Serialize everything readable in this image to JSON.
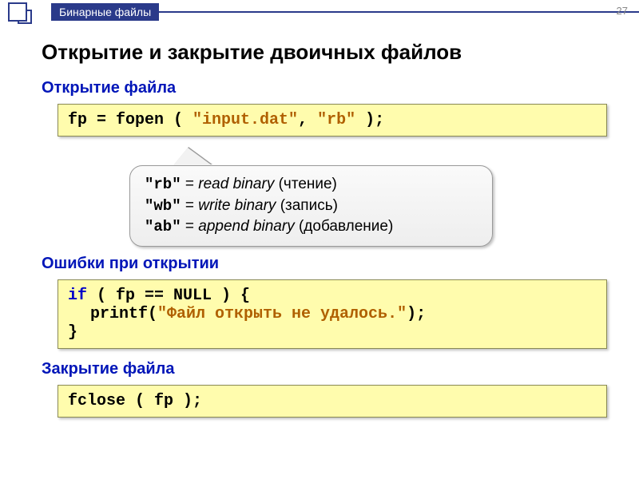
{
  "header": {
    "breadcrumb": "Бинарные файлы",
    "page_number": "27"
  },
  "title": "Открытие и закрытие двоичных файлов",
  "sections": {
    "open": {
      "heading": "Открытие файла",
      "code_pre": "fp = fopen ( ",
      "code_arg1": "\"input.dat\"",
      "code_comma": ", ",
      "code_arg2": "\"rb\"",
      "code_post": " );"
    },
    "modes": {
      "rb_code": "\"rb\"",
      "rb_eq": " = ",
      "rb_meaning": "read binary",
      "rb_ru": " (чтение)",
      "wb_code": "\"wb\"",
      "wb_eq": " = ",
      "wb_meaning": "write binary",
      "wb_ru": " (запись)",
      "ab_code": "\"ab\"",
      "ab_eq": " = ",
      "ab_meaning": "append binary",
      "ab_ru": " (добавление)"
    },
    "errors": {
      "heading": "Ошибки при открытии",
      "l1a": "if",
      "l1b": " ( fp == NULL ) {",
      "l2a": "printf(",
      "l2b": "\"Файл открыть не удалось.\"",
      "l2c": ");",
      "l3": "}"
    },
    "close": {
      "heading": "Закрытие файла",
      "code": "fclose ( fp );"
    }
  }
}
